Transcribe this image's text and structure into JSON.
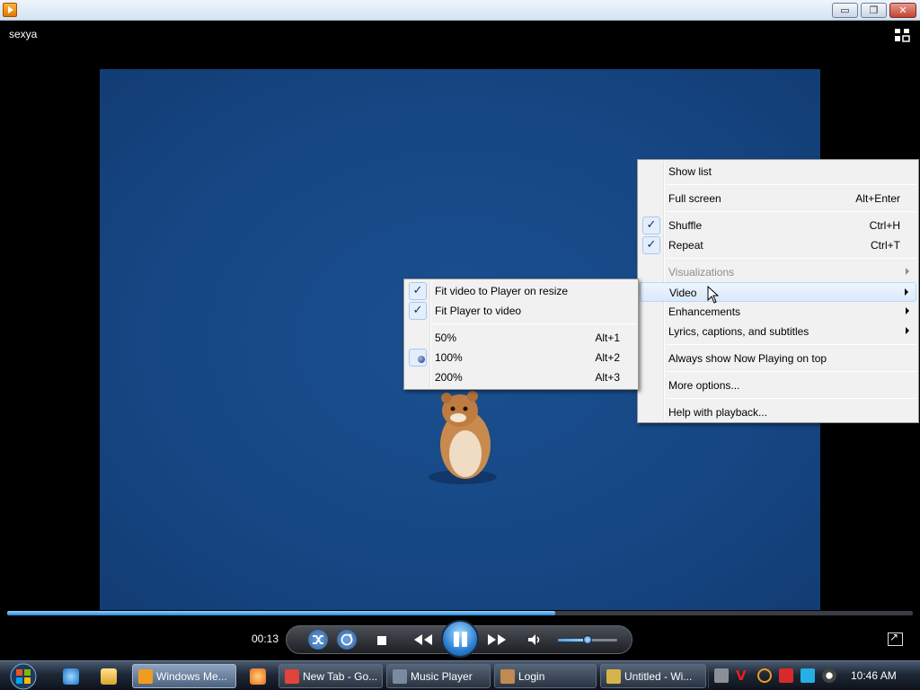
{
  "window": {
    "buttons": {
      "minimize": "▭",
      "maximize": "❐",
      "close": "✕"
    }
  },
  "player": {
    "media_title": "sexya",
    "elapsed": "00:13",
    "seek_progress": 0.605,
    "volume_level": 0.5,
    "state": "playing"
  },
  "main_menu": {
    "items": [
      {
        "label": "Show list",
        "shortcut": "",
        "checked": false,
        "submenu": false,
        "disabled": false
      },
      {
        "label": "Full screen",
        "shortcut": "Alt+Enter",
        "checked": false,
        "submenu": false,
        "disabled": false
      },
      {
        "label": "Shuffle",
        "shortcut": "Ctrl+H",
        "checked": true,
        "submenu": false,
        "disabled": false
      },
      {
        "label": "Repeat",
        "shortcut": "Ctrl+T",
        "checked": true,
        "submenu": false,
        "disabled": false
      },
      {
        "label": "Visualizations",
        "shortcut": "",
        "checked": false,
        "submenu": true,
        "disabled": true
      },
      {
        "label": "Video",
        "shortcut": "",
        "checked": false,
        "submenu": true,
        "disabled": false,
        "highlighted": true
      },
      {
        "label": "Enhancements",
        "shortcut": "",
        "checked": false,
        "submenu": true,
        "disabled": false
      },
      {
        "label": "Lyrics, captions, and subtitles",
        "shortcut": "",
        "checked": false,
        "submenu": true,
        "disabled": false
      },
      {
        "label": "Always show Now Playing on top",
        "shortcut": "",
        "checked": false,
        "submenu": false,
        "disabled": false
      },
      {
        "label": "More options...",
        "shortcut": "",
        "checked": false,
        "submenu": false,
        "disabled": false
      },
      {
        "label": "Help with playback...",
        "shortcut": "",
        "checked": false,
        "submenu": false,
        "disabled": false
      }
    ]
  },
  "video_submenu": {
    "items": [
      {
        "label": "Fit video to Player on resize",
        "shortcut": "",
        "mark": "check"
      },
      {
        "label": "Fit Player to video",
        "shortcut": "",
        "mark": "check"
      },
      {
        "label": "50%",
        "shortcut": "Alt+1",
        "mark": ""
      },
      {
        "label": "100%",
        "shortcut": "Alt+2",
        "mark": "radio"
      },
      {
        "label": "200%",
        "shortcut": "Alt+3",
        "mark": ""
      }
    ]
  },
  "taskbar": {
    "tasks": [
      {
        "label": "Windows Me...",
        "icon": "media-player-icon",
        "color": "#f29b20",
        "active": true
      },
      {
        "label": "New Tab - Go...",
        "icon": "chrome-icon",
        "color": "#e0443a",
        "active": false
      },
      {
        "label": "Music Player",
        "icon": "music-player-icon",
        "color": "#7a8aa0",
        "active": false
      },
      {
        "label": "Login",
        "icon": "login-icon",
        "color": "#c08a50",
        "active": false
      },
      {
        "label": "Untitled - Wi...",
        "icon": "paint-icon",
        "color": "#d6b44a",
        "active": false
      }
    ],
    "clock": "10:46 AM"
  },
  "colors": {
    "video_background": "#164784",
    "accent": "#2d7fd0"
  }
}
